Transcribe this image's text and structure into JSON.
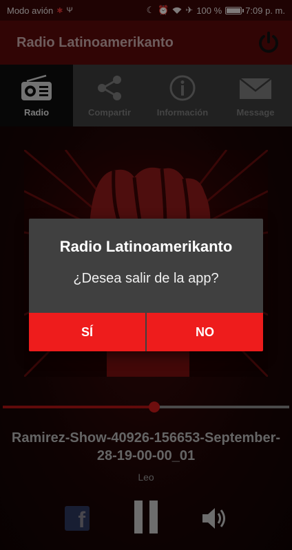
{
  "status": {
    "mode": "Modo avión",
    "battery": "100 %",
    "battery_level": 1.0,
    "time": "7:09 p. m."
  },
  "app": {
    "title": "Radio Latinoamerikanto"
  },
  "tabs": [
    {
      "label": "Radio",
      "icon": "radio-icon",
      "active": true
    },
    {
      "label": "Compartir",
      "icon": "share-icon",
      "active": false
    },
    {
      "label": "Información",
      "icon": "info-icon",
      "active": false
    },
    {
      "label": "Message",
      "icon": "mail-icon",
      "active": false
    }
  ],
  "player": {
    "progress": 0.53,
    "track": "Ramirez-Show-40926-156653-September-28-19-00-00_01",
    "artist": "Leo",
    "facebook_glyph": "f"
  },
  "dialog": {
    "title": "Radio Latinoamerikanto",
    "message": "¿Desea salir de la app?",
    "yes": "SÍ",
    "no": "NO"
  },
  "colors": {
    "accent": "#ee1c1c",
    "app_bar": "#5a0a0a"
  }
}
